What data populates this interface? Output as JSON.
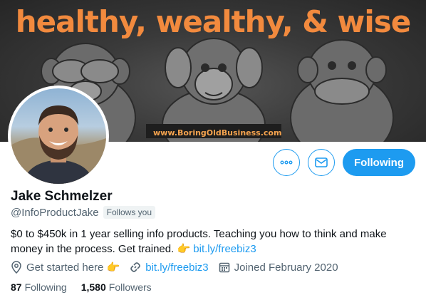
{
  "banner": {
    "headline": "healthy, wealthy, & wise",
    "url": "www.BoringOldBusiness.com"
  },
  "actions": {
    "more_icon": "more-icon",
    "message_icon": "envelope-icon",
    "follow_label": "Following"
  },
  "profile": {
    "name": "Jake Schmelzer",
    "handle": "@InfoProductJake",
    "follows_you": "Follows you",
    "bio_text": "$0 to $450k in 1 year selling info products. Teaching you how to think and make money in the process.  Get trained. 👉 ",
    "bio_link": "bit.ly/freebiz3",
    "location": "Get started here 👉",
    "website": "bit.ly/freebiz3",
    "joined": "Joined February 2020"
  },
  "stats": {
    "following_count": "87",
    "following_label": "Following",
    "followers_count": "1,580",
    "followers_label": "Followers"
  },
  "colors": {
    "accent": "#1d9bf0",
    "headline": "#f28a3e"
  }
}
